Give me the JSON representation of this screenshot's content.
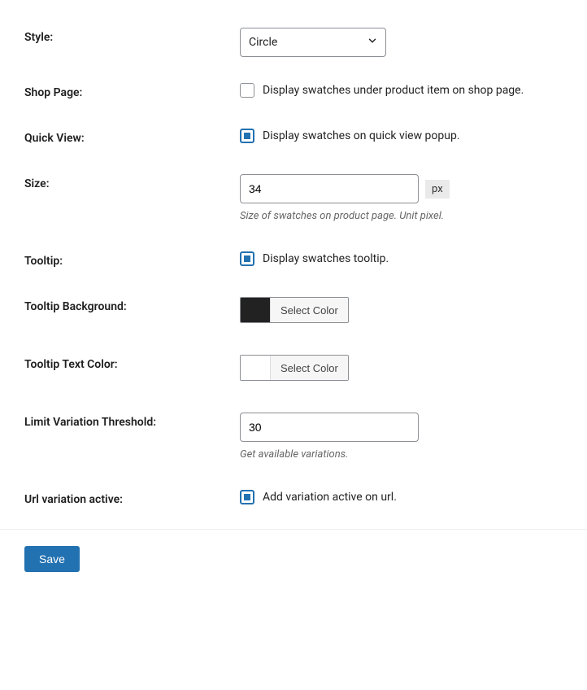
{
  "fields": {
    "style": {
      "label": "Style:",
      "value": "Circle"
    },
    "shop_page": {
      "label": "Shop Page:",
      "check_label": "Display swatches under product item on shop page.",
      "checked": false
    },
    "quick_view": {
      "label": "Quick View:",
      "check_label": "Display swatches on quick view popup.",
      "checked": true
    },
    "size": {
      "label": "Size:",
      "value": "34",
      "unit": "px",
      "hint": "Size of swatches on product page. Unit pixel."
    },
    "tooltip": {
      "label": "Tooltip:",
      "check_label": "Display swatches tooltip.",
      "checked": true
    },
    "tooltip_bg": {
      "label": "Tooltip Background:",
      "color": "#222222",
      "btn": "Select Color"
    },
    "tooltip_text": {
      "label": "Tooltip Text Color:",
      "color": "#ffffff",
      "btn": "Select Color"
    },
    "limit_variation": {
      "label": "Limit Variation Threshold:",
      "value": "30",
      "hint": "Get available variations."
    },
    "url_variation": {
      "label": "Url variation active:",
      "check_label": "Add variation active on url.",
      "checked": true
    }
  },
  "save_btn": "Save"
}
